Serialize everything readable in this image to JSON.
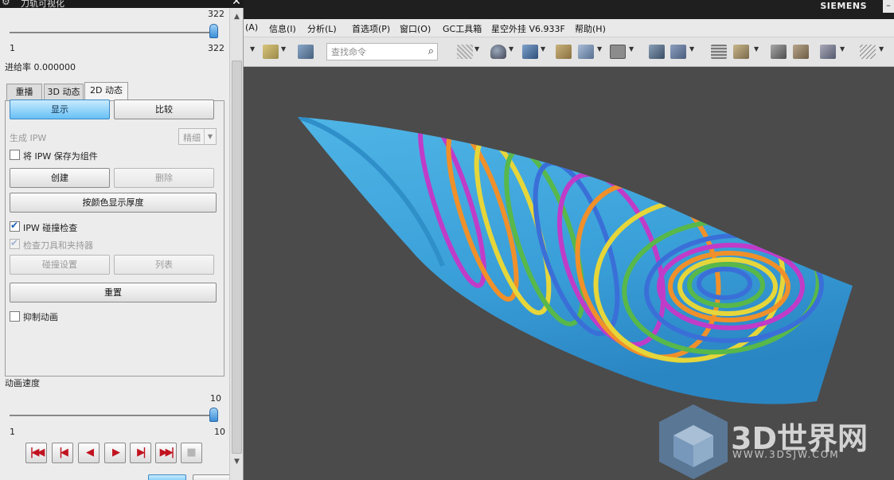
{
  "dialog": {
    "title": "刀轨可视化",
    "close_glyph": "✕",
    "top_slider": {
      "max_label": "322",
      "min_label": "1",
      "max_value": "322"
    },
    "progress_text": "进给率 0.000000",
    "tabs": [
      {
        "label": "重播"
      },
      {
        "label": "3D 动态"
      },
      {
        "label": "2D 动态"
      }
    ],
    "active_tab": "2D 动态",
    "buttons": {
      "show": "显示",
      "compare": "比较",
      "create": "创建",
      "delete": "删除",
      "show_thickness": "按颜色显示厚度",
      "collision_settings": "碰撞设置",
      "list": "列表",
      "reset": "重置"
    },
    "generate_ipw_label": "生成 IPW",
    "ipw_precision_value": "精细",
    "save_ipw_as_component": {
      "label": "将 IPW 保存为组件",
      "checked": false
    },
    "ipw_collision_check": {
      "label": "IPW 碰撞检查",
      "checked": true
    },
    "check_tool_holder": {
      "label": "检查刀具和夹持器",
      "checked": true
    },
    "suppress_animation": {
      "label": "抑制动画",
      "checked": false
    },
    "speed": {
      "label": "动画速度",
      "max_label": "10",
      "min_label": "1",
      "value_label": "10"
    },
    "playback_buttons": [
      "skip-to-start",
      "step-back",
      "play-reverse",
      "play",
      "step-forward",
      "skip-to-end",
      "stop"
    ]
  },
  "app": {
    "brand": "SIEMENS",
    "window_button": "–",
    "menus": [
      "\u0001(A)",
      "信息(I)",
      "分析(L)",
      "首选项(P)",
      "窗口(O)",
      "GC工具箱",
      "星空外挂 V6.933F",
      "帮助(H)"
    ],
    "menu_labels": {
      "first": "(A)",
      "info": "信息(I)",
      "analysis": "分析(L)",
      "prefs": "首选项(P)",
      "window": "窗口(O)",
      "gc": "GC工具箱",
      "plugin": "星空外挂 V6.933F",
      "help": "帮助(H)"
    },
    "search": {
      "placeholder": "查找命令"
    }
  },
  "watermark": {
    "text": "3D世界网",
    "url": "WWW.3DSJW.COM"
  },
  "colors": {
    "part_blue": "#3a9fd8",
    "ring_colors": [
      "#c03cc8",
      "#f0902a",
      "#e6d63a",
      "#58b84a",
      "#3a6fd8"
    ],
    "accent_button": "#67c0f5"
  }
}
